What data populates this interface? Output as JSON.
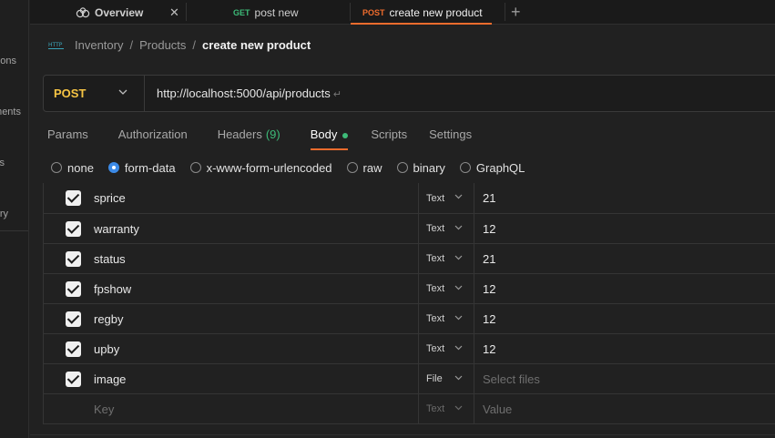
{
  "sidebar": {
    "fragments": [
      "ions",
      "ments",
      "s",
      "ry"
    ]
  },
  "tabs": [
    {
      "label": "Overview",
      "method": "",
      "close": "✕"
    },
    {
      "label": "post new",
      "method": "GET",
      "method_color": "#3dbb78"
    },
    {
      "label": "create new product",
      "method": "POST",
      "method_color": "#ef6c2d"
    }
  ],
  "new_tab_label": "+",
  "breadcrumb": {
    "items": [
      "Inventory",
      "Products"
    ],
    "separator": "/",
    "current": "create new product"
  },
  "request": {
    "method": "POST",
    "url": "http://localhost:5000/api/products",
    "return_symbol": "↵"
  },
  "request_tabs": [
    {
      "label": "Params"
    },
    {
      "label": "Authorization"
    },
    {
      "label": "Headers",
      "count": "(9)"
    },
    {
      "label": "Body"
    },
    {
      "label": "Scripts"
    },
    {
      "label": "Settings"
    }
  ],
  "body_types": [
    "none",
    "form-data",
    "x-www-form-urlencoded",
    "raw",
    "binary",
    "GraphQL"
  ],
  "selected_body_type": "form-data",
  "form_rows": [
    {
      "key": "sprice",
      "type": "Text",
      "value": "21"
    },
    {
      "key": "warranty",
      "type": "Text",
      "value": "12"
    },
    {
      "key": "status",
      "type": "Text",
      "value": "21"
    },
    {
      "key": "fpshow",
      "type": "Text",
      "value": "12"
    },
    {
      "key": "regby",
      "type": "Text",
      "value": "12"
    },
    {
      "key": "upby",
      "type": "Text",
      "value": "12"
    },
    {
      "key": "image",
      "type": "File",
      "value": "Select files"
    }
  ],
  "empty_row": {
    "key_placeholder": "Key",
    "type": "Text",
    "value_placeholder": "Value"
  },
  "colors": {
    "accent": "#ef6c2d",
    "post": "#f6c444",
    "green": "#3dbb78",
    "radio": "#3c8ae6"
  }
}
